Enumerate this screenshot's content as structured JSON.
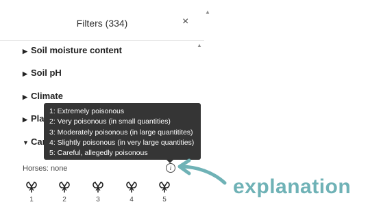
{
  "panel": {
    "title": "Filters (334)",
    "close_glyph": "×",
    "sections": [
      {
        "label": "Soil moisture content",
        "expanded": false
      },
      {
        "label": "Soil pH",
        "expanded": false
      },
      {
        "label": "Climate",
        "expanded": false
      },
      {
        "label": "Pla",
        "expanded": false
      },
      {
        "label": "Car",
        "expanded": true
      }
    ]
  },
  "tooltip": {
    "lines": [
      "1: Extremely poisonous",
      "2: Very poisonous (in small quantities)",
      "3: Moderately poisonous (in large quantitites)",
      "4: Slightly poisonous (in very large quantities)",
      "5: Careful, allegedly poisonous"
    ]
  },
  "toxicity": {
    "label": "Horses: none",
    "info_glyph": "i",
    "levels": [
      "1",
      "2",
      "3",
      "4",
      "5"
    ],
    "icon": "toxic-plant-icon"
  },
  "annotation": {
    "text": "explanation",
    "color": "#6fb2b6"
  }
}
